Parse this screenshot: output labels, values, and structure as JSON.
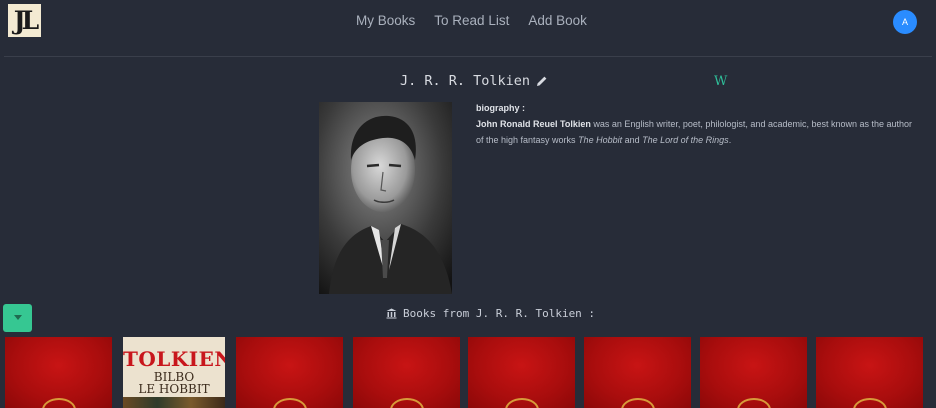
{
  "logo": {
    "text": "JL"
  },
  "nav": {
    "items": [
      "My Books",
      "To Read List",
      "Add Book"
    ]
  },
  "user": {
    "initial": "A"
  },
  "author": {
    "name": "J. R. R. Tolkien",
    "wiki_label": "W",
    "bio_label": "biography :",
    "bio_name": "John Ronald Reuel Tolkien",
    "bio_part1": " was an English writer, poet, philologist, and academic, best known as the author of the high fantasy works ",
    "bio_work1": "The Hobbit",
    "bio_part2": " and ",
    "bio_work2": "The Lord of the Rings",
    "bio_part3": "."
  },
  "books": {
    "heading": "Books from J. R. R. Tolkien :",
    "second_cover": {
      "title": "TOLKIEN",
      "line1": "BILBO",
      "line2": "LE HOBBIT"
    }
  },
  "colors": {
    "background": "#272c38",
    "accent": "#36c792",
    "avatar": "#2a8cff",
    "cover_red": "#b80f0f"
  }
}
